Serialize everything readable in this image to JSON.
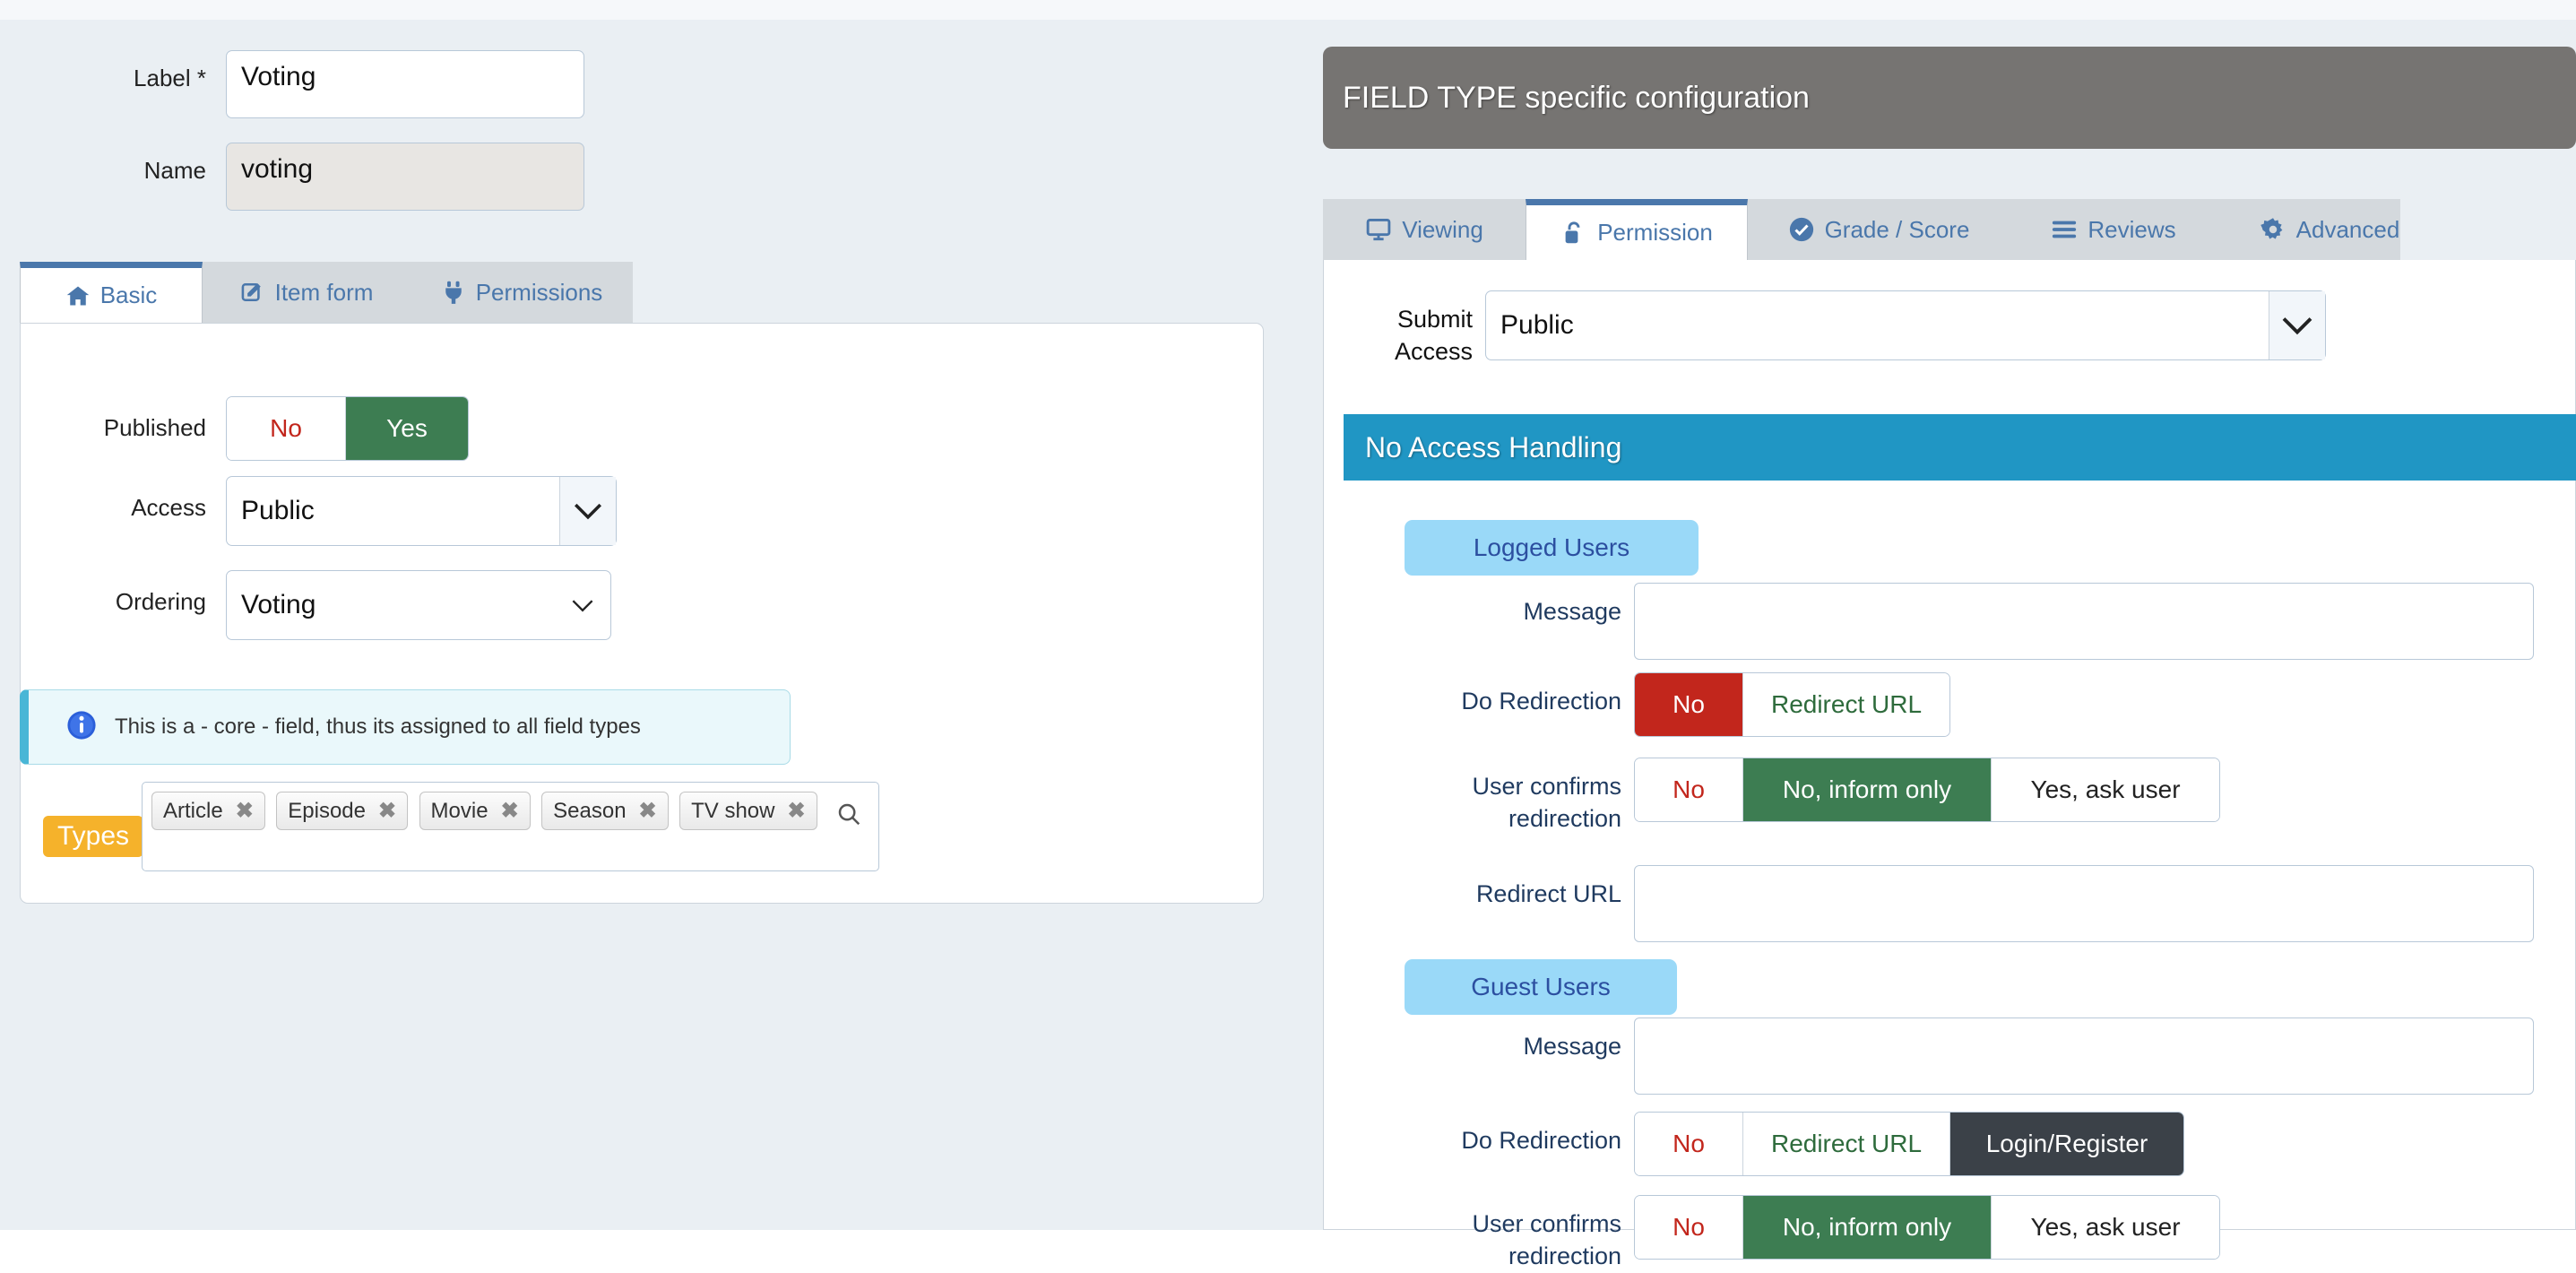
{
  "left": {
    "fields": {
      "label_label": "Label *",
      "label_value": "Voting",
      "name_label": "Name",
      "name_value": "voting"
    },
    "tabs": [
      {
        "label": "Basic",
        "icon": "home-icon",
        "active": true
      },
      {
        "label": "Item form",
        "icon": "edit-icon",
        "active": false
      },
      {
        "label": "Permissions",
        "icon": "plug-icon",
        "active": false
      }
    ],
    "published": {
      "label": "Published",
      "options": [
        "No",
        "Yes"
      ],
      "selected": "Yes"
    },
    "access": {
      "label": "Access",
      "value": "Public"
    },
    "ordering": {
      "label": "Ordering",
      "value": "Voting"
    },
    "alert": {
      "icon": "info-icon",
      "text": "This is a - core - field, thus its assigned to all field types"
    },
    "types": {
      "badge": "Types",
      "tags": [
        "Article",
        "Episode",
        "Movie",
        "Season",
        "TV show"
      ],
      "remove_glyph": "✖",
      "search_icon": "search-icon"
    }
  },
  "right": {
    "header_title": "FIELD TYPE specific configuration",
    "tabs": [
      {
        "label": "Viewing",
        "icon": "monitor-icon",
        "active": false
      },
      {
        "label": "Permission",
        "icon": "unlock-icon",
        "active": true
      },
      {
        "label": "Grade / Score",
        "icon": "check-circle-icon",
        "active": false
      },
      {
        "label": "Reviews",
        "icon": "list-icon",
        "active": false
      },
      {
        "label": "Advanced",
        "icon": "gear-icon",
        "active": false
      }
    ],
    "submit_access": {
      "label": "Submit Access",
      "value": "Public"
    },
    "no_access_handling": {
      "title": "No Access Handling",
      "groups": [
        {
          "pill": "Logged Users",
          "message_label": "Message",
          "message_value": "",
          "do_redirection": {
            "label": "Do Redirection",
            "options": [
              "No",
              "Redirect URL"
            ],
            "selected": "No"
          },
          "user_confirms": {
            "label_line1": "User confirms",
            "label_line2": "redirection",
            "options": [
              "No",
              "No, inform only",
              "Yes, ask user"
            ],
            "selected": "No, inform only"
          },
          "redirect_url_label": "Redirect URL",
          "redirect_url_value": ""
        },
        {
          "pill": "Guest Users",
          "message_label": "Message",
          "message_value": "",
          "do_redirection": {
            "label": "Do Redirection",
            "options": [
              "No",
              "Redirect URL",
              "Login/Register"
            ],
            "selected": "Login/Register"
          },
          "user_confirms": {
            "label_line1": "User confirms",
            "label_line2": "redirection",
            "options": [
              "No",
              "No, inform only",
              "Yes, ask user"
            ],
            "selected": "No, inform only"
          }
        }
      ]
    }
  },
  "colors": {
    "accent_blue": "#4a77ab",
    "section_blue": "#2096c4",
    "pill_blue": "#9ad9f8",
    "green_on": "#3d7d52",
    "red_on": "#c2261c",
    "dark_on": "#3b4148",
    "amber": "#f5b22b",
    "header_gray": "#767472"
  }
}
